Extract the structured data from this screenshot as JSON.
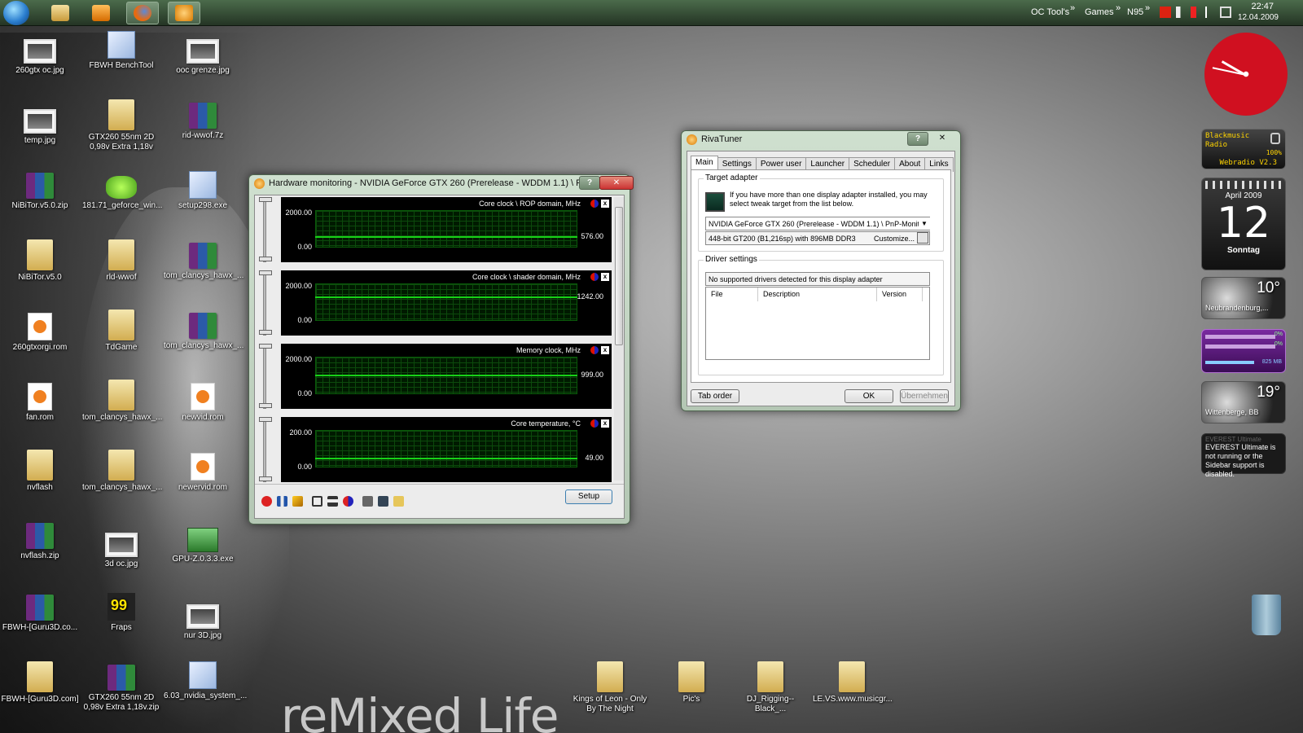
{
  "taskbar": {
    "toolbars": [
      "OC Tool's",
      "Games",
      "N95"
    ],
    "clock_time": "22:47",
    "clock_date": "12.04.2009",
    "chevrons": "»"
  },
  "desktop_icons": [
    {
      "label": "260gtx oc.jpg",
      "type": "jpg"
    },
    {
      "label": "FBWH BenchTool",
      "type": "exe"
    },
    {
      "label": "ooc grenze.jpg",
      "type": "jpg"
    },
    {
      "label": "temp.jpg",
      "type": "jpg"
    },
    {
      "label": "GTX260 55nm 2D 0,98v Extra 1,18v",
      "type": "folder"
    },
    {
      "label": "rid-wwof.7z",
      "type": "rar"
    },
    {
      "label": "NiBiTor.v5.0.zip",
      "type": "rar"
    },
    {
      "label": "181.71_geforce_win...",
      "type": "nv"
    },
    {
      "label": "setup298.exe",
      "type": "exe"
    },
    {
      "label": "NiBiTor.v5.0",
      "type": "folder"
    },
    {
      "label": "rld-wwof",
      "type": "folder"
    },
    {
      "label": "tom_clancys_hawx_...",
      "type": "rar"
    },
    {
      "label": "260gtxorgi.rom",
      "type": "rom"
    },
    {
      "label": "TdGame",
      "type": "folder"
    },
    {
      "label": "tom_clancys_hawx_...",
      "type": "rar"
    },
    {
      "label": "fan.rom",
      "type": "rom"
    },
    {
      "label": "tom_clancys_hawx_...",
      "type": "folder"
    },
    {
      "label": "newvid.rom",
      "type": "rom"
    },
    {
      "label": "nvflash",
      "type": "folder"
    },
    {
      "label": "tom_clancys_hawx_...",
      "type": "folder"
    },
    {
      "label": "newervid.rom",
      "type": "rom"
    },
    {
      "label": "nvflash.zip",
      "type": "rar"
    },
    {
      "label": "3d oc.jpg",
      "type": "jpg"
    },
    {
      "label": "GPU-Z.0.3.3.exe",
      "type": "gpu"
    },
    {
      "label": "FBWH-[Guru3D.co...",
      "type": "rar"
    },
    {
      "label": "Fraps",
      "type": "fraps"
    },
    {
      "label": "nur 3D.jpg",
      "type": "jpg"
    },
    {
      "label": "FBWH-[Guru3D.com]",
      "type": "folder"
    },
    {
      "label": "GTX260 55nm 2D 0,98v Extra 1,18v.zip",
      "type": "rar"
    },
    {
      "label": "6.03_nvidia_system_...",
      "type": "exe"
    },
    {
      "label": "Kings of Leon - Only By The Night",
      "type": "folder"
    },
    {
      "label": "Pic's",
      "type": "folder"
    },
    {
      "label": "DJ_Rigging--Black_...",
      "type": "folder"
    },
    {
      "label": "LE.VS.www.musicgr...",
      "type": "folder"
    }
  ],
  "fraps_badge": "99",
  "wallpaper_text": "reMixed Life",
  "hw_monitor": {
    "title": "Hardware monitoring - NVIDIA GeForce GTX 260 (Prerelease - WDDM 1.1) \\ PnP-M...",
    "help": "?",
    "close": "✕",
    "panels": [
      {
        "label": "Core clock \\ ROP domain, MHz",
        "max": "2000.00",
        "min": "0.00",
        "value": "576.00",
        "level": 0.288
      },
      {
        "label": "Core clock \\ shader domain, MHz",
        "max": "2000.00",
        "min": "0.00",
        "value": "1242.00",
        "level": 0.621
      },
      {
        "label": "Memory clock, MHz",
        "max": "2000.00",
        "min": "0.00",
        "value": "999.00",
        "level": 0.4995
      },
      {
        "label": "Core temperature, °C",
        "max": "200.00",
        "min": "0.00",
        "value": "49.00",
        "level": 0.245
      }
    ],
    "panel_close": "x",
    "setup": "Setup"
  },
  "rivatuner": {
    "title": "RivaTuner",
    "help": "?",
    "close": "✕",
    "tabs": [
      "Main",
      "Settings",
      "Power user",
      "Launcher",
      "Scheduler",
      "About",
      "Links"
    ],
    "target_adapter_label": "Target adapter",
    "target_adapter_text": "If you have more than one display adapter installed, you may select tweak target from the list below.",
    "adapter_select": "NVIDIA GeForce GTX 260 (Prerelease - WDDM 1.1) \\ PnP-Monit",
    "adapter_info": "448-bit GT200 (B1,216sp) with 896MB DDR3",
    "customize": "Customize...",
    "driver_settings_label": "Driver settings",
    "driver_status": "No supported drivers detected for this display adapter",
    "columns": [
      "File",
      "Description",
      "Version"
    ],
    "tab_order": "Tab order",
    "ok": "OK",
    "apply": "Übernehmen"
  },
  "gadgets": {
    "radio_name": "Blackmusic Radio",
    "radio_volume": "100%",
    "radio_brand": "Webradio V2.3",
    "cal_month": "April 2009",
    "cal_day": "12",
    "cal_weekday": "Sonntag",
    "weather1_temp": "10°",
    "weather1_city": "Neubrandenburg,...",
    "meter_pct1": "0%",
    "meter_pct2": "0%",
    "meter_mem": "825 MB",
    "meter_level": 0.7,
    "weather2_temp": "19°",
    "weather2_city": "Wittenberge, BB",
    "everest_title": "EVEREST Ultimate",
    "everest_text": "EVEREST Ultimate is not running or the Sidebar support is disabled."
  }
}
